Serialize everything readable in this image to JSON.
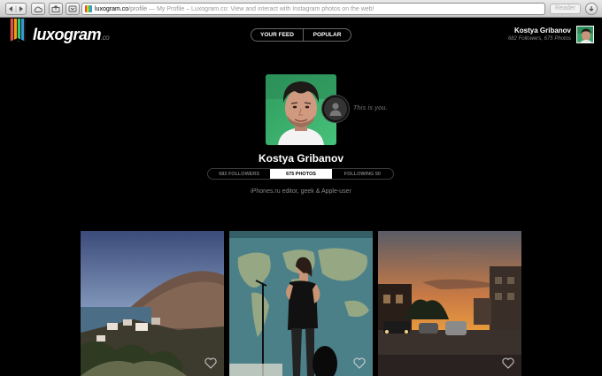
{
  "browser": {
    "url_domain": "luxogram.co",
    "url_path": "/profile",
    "page_title": "— My Profile – Luxogram.co: View and interact with Instagram photos on the web!",
    "reader_label": "Reader"
  },
  "header": {
    "logo_text": "luxogram",
    "logo_suffix": ".co",
    "nav": [
      {
        "label": "YOUR FEED"
      },
      {
        "label": "POPULAR"
      }
    ],
    "user_name": "Kostya Gribanov",
    "user_stats": "682 Followers, 675 Photos"
  },
  "profile": {
    "you_label": "This is you.",
    "name": "Kostya Gribanov",
    "stats": {
      "followers": "682 FOLLOWERS",
      "photos": "675 PHOTOS",
      "following": "FOLLOWING 50"
    },
    "bio": "iPhones.ru editor, geek & Apple-user"
  },
  "colors": {
    "background": "#000000",
    "active_tab": "#ffffff",
    "muted_text": "#888888"
  },
  "photos": [
    {
      "subject": "coastal village"
    },
    {
      "subject": "singer with world map"
    },
    {
      "subject": "sunset street"
    }
  ]
}
